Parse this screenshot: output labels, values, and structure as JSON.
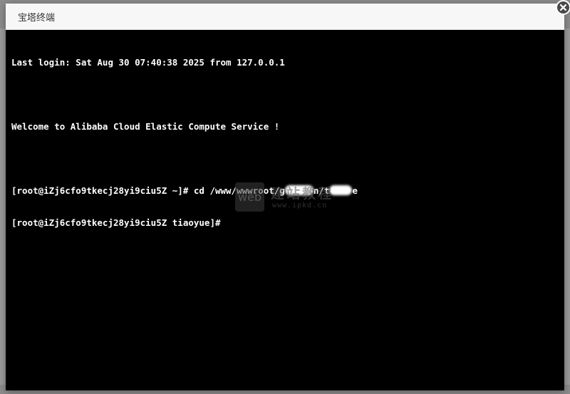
{
  "modal": {
    "title": "宝塔终端",
    "close_icon": "close-icon"
  },
  "terminal": {
    "last_login": "Last login: Sat Aug 30 07:40:38 2025 from 127.0.0.1",
    "welcome": "Welcome to Alibaba Cloud Elastic Compute Service !",
    "prompt1": "[root@iZj6cfo9tkecj28yi9ciu5Z ~]# cd /www/wwwroot/g",
    "prompt1_mid": "n/t",
    "prompt1_end": "e",
    "prompt2": "[root@iZj6cfo9tkecj28yi9ciu5Z tiaoyue]#"
  },
  "watermark": {
    "logo": "web",
    "chinese": "建站教程",
    "url": "www.ipkd.cn"
  },
  "colors": {
    "terminal_bg": "#000000",
    "terminal_fg": "#ffffff",
    "header_bg": "#f7f7f7"
  }
}
